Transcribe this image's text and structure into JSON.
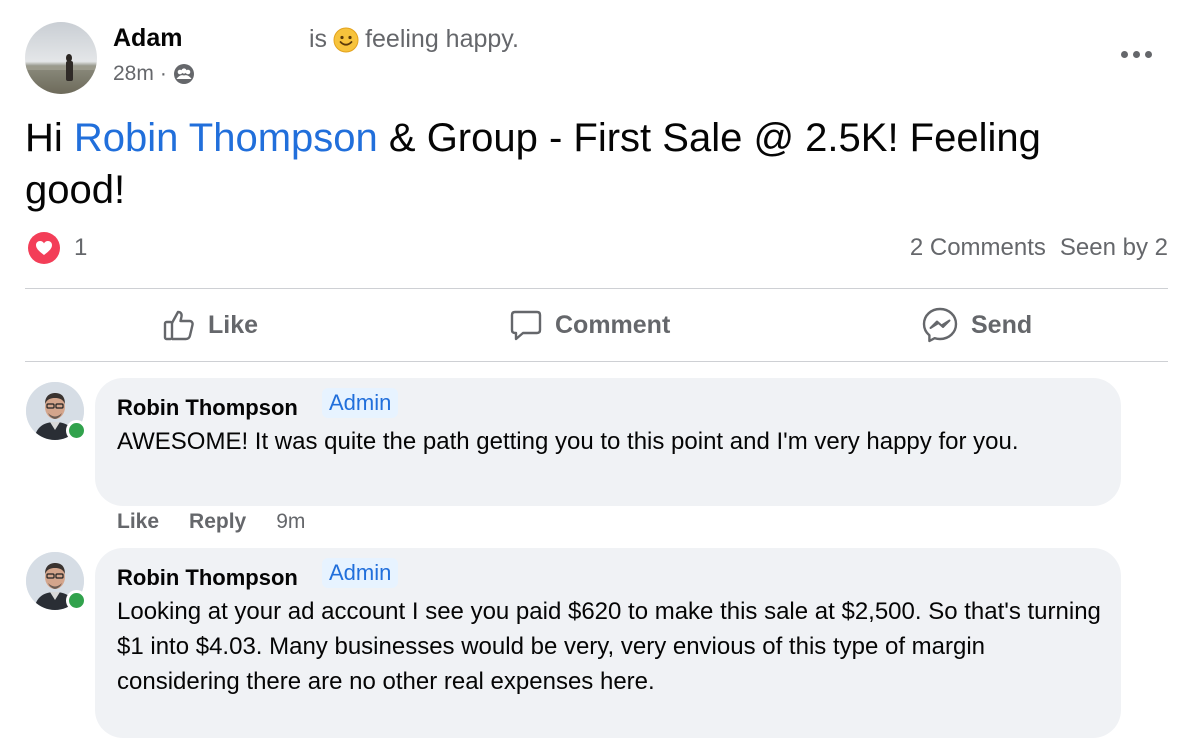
{
  "post": {
    "author": "Adam",
    "feeling_prefix": "is",
    "feeling_text": "feeling happy.",
    "time": "28m",
    "meta_separator": "·",
    "text_prefix": "Hi ",
    "mention": "Robin Thompson",
    "text_suffix": " & Group - First Sale @ 2.5K! Feeling good!",
    "reaction_count": "1",
    "comments_count": "2 Comments",
    "seen_by": "Seen by 2"
  },
  "actions": {
    "like": "Like",
    "comment": "Comment",
    "send": "Send"
  },
  "comments": [
    {
      "author": "Robin Thompson",
      "badge": "Admin",
      "text": "AWESOME! It was quite the path getting you to this point and I'm very happy for you.",
      "like": "Like",
      "reply": "Reply",
      "time": "9m"
    },
    {
      "author": "Robin Thompson",
      "badge": "Admin",
      "text": "Looking at your ad account I see you paid $620 to make this sale at $2,500. So that's turning $1 into $4.03. Many businesses would be very, very envious of this type of margin considering there are no other real expenses here."
    }
  ],
  "colors": {
    "mention_blue": "#216fdb",
    "secondary_text": "#65676b",
    "bubble_bg": "#f0f2f5",
    "love_red": "#f33e58",
    "online_green": "#31a24c"
  },
  "icons": {
    "feeling": "smiley-face-icon",
    "audience": "group-icon",
    "menu": "more-options-icon",
    "reaction": "heart-reaction-icon",
    "like": "thumbs-up-icon",
    "comment": "comment-bubble-icon",
    "send": "messenger-icon"
  }
}
